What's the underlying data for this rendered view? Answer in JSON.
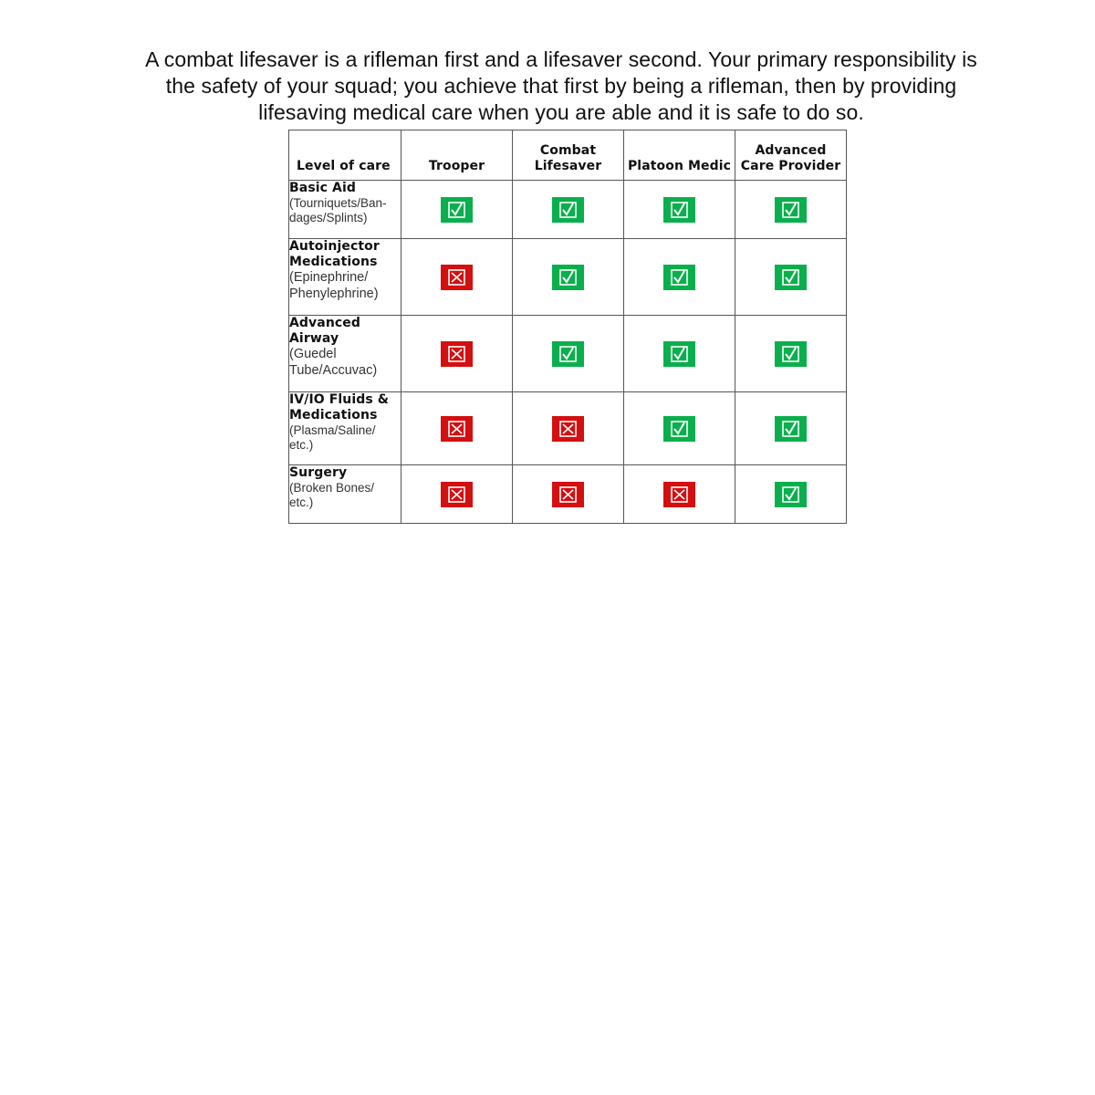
{
  "intro": "A combat lifesaver is a rifleman first and a lifesaver second. Your primary responsibility is the safety of your squad; you achieve that first by being a rifleman, then by providing lifesaving medical care when you are able and it is safe to do so.",
  "table": {
    "headers": [
      "Level of care",
      "Trooper",
      "Combat Lifesaver",
      "Platoon Medic",
      "Advanced Care Provider"
    ],
    "rows": [
      {
        "label": "Basic Aid",
        "detail": "(Tourniquets/Ban-dages/Splints)",
        "marks": [
          true,
          true,
          true,
          true
        ]
      },
      {
        "label": "Autoinjector Medications",
        "detail": "(Epinephrine/ Phenylephrine)",
        "marks": [
          false,
          true,
          true,
          true
        ]
      },
      {
        "label": "Advanced Airway",
        "detail": "(Guedel Tube/Accuvac)",
        "marks": [
          false,
          true,
          true,
          true
        ]
      },
      {
        "label": "IV/IO Fluids & Medications",
        "detail": "(Plasma/Saline/ etc.)",
        "marks": [
          false,
          false,
          true,
          true
        ]
      },
      {
        "label": "Surgery",
        "detail": "(Broken Bones/ etc.)",
        "marks": [
          false,
          false,
          false,
          true
        ]
      }
    ]
  },
  "colors": {
    "check": "#0aaf4d",
    "cross": "#d40f10"
  },
  "icons": {
    "allowed": "checked-box-icon",
    "not_allowed": "crossed-box-icon"
  }
}
